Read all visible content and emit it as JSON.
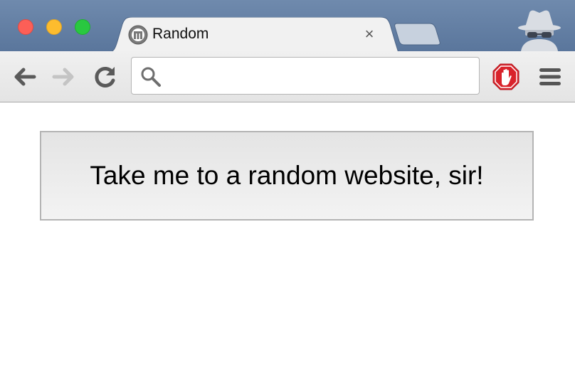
{
  "browser": {
    "tab": {
      "title": "Random",
      "close_label": "×"
    },
    "omnibox": {
      "value": "",
      "placeholder": ""
    },
    "colors": {
      "titlebar": "#5a769c",
      "close_light": "#fc5f57",
      "minimize_light": "#fdbc2e",
      "maximize_light": "#29c840",
      "adblock_red": "#d9232b"
    }
  },
  "page": {
    "random_button_label": "Take me to a random website, sir!"
  }
}
